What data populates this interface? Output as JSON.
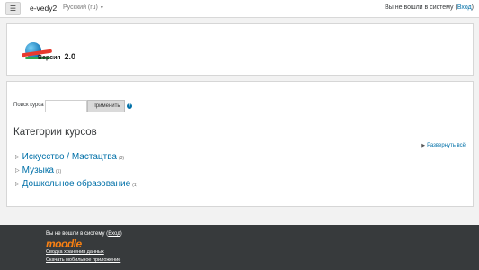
{
  "navbar": {
    "site_name": "e-vedy2",
    "language": "Русский (ru)",
    "login_text": "Вы не вошли в систему",
    "login_link": "Вход"
  },
  "logo": {
    "text": "Версия",
    "version": "2.0"
  },
  "search": {
    "label": "Поиск курса",
    "value": "",
    "button": "Применить"
  },
  "categories": {
    "heading": "Категории курсов",
    "expand_all": "Развернуть всё",
    "items": [
      {
        "name": "Искусство / Мастацтва",
        "count": "(3)"
      },
      {
        "name": "Музыка",
        "count": "(1)"
      },
      {
        "name": "Дошкольное образование",
        "count": "(1)"
      }
    ]
  },
  "footer": {
    "login_text": "Вы не вошли в систему",
    "login_link": "Вход",
    "logo": "moodle",
    "data_retention": "Сводка хранения данных",
    "mobile_app": "Скачать мобильное приложение"
  },
  "colors": {
    "link": "#0070a8",
    "footer_bg": "#373a3c",
    "moodle_orange": "#f98012"
  }
}
